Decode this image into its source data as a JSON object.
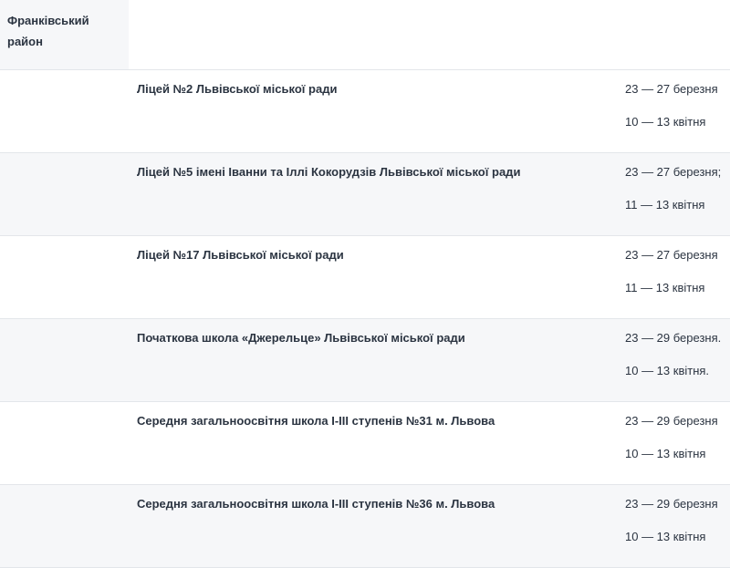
{
  "district": "Франківський район",
  "schools": [
    {
      "name": "Ліцей №2 Львівської міської ради",
      "dates": [
        "23 — 27 березня",
        "10 — 13 квітня"
      ]
    },
    {
      "name": "Ліцей №5 імені Іванни та Іллі Кокорудзів Львівської міської ради",
      "dates": [
        "23 — 27 березня;",
        "11 — 13 квітня"
      ]
    },
    {
      "name": "Ліцей №17 Львівської міської ради",
      "dates": [
        "23 — 27 березня",
        "11 — 13 квітня"
      ]
    },
    {
      "name": "Початкова школа «Джерельце» Львівської міської ради",
      "dates": [
        "23 — 29 березня.",
        "10 — 13 квітня."
      ]
    },
    {
      "name": "Середня загальноосвітня школа І-ІІІ ступенів №31 м. Львова",
      "dates": [
        "23 — 29 березня",
        "10 — 13 квітня"
      ]
    },
    {
      "name": "Середня загальноосвітня школа І-ІІІ ступенів №36 м. Львова",
      "dates": [
        "23 — 29 березня",
        "10 — 13 квітня"
      ]
    }
  ]
}
